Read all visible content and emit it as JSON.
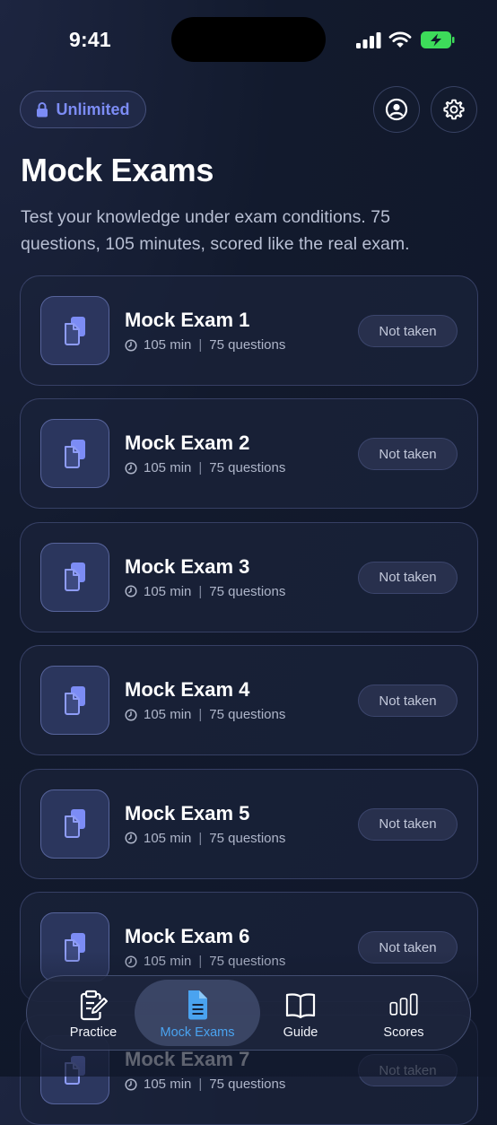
{
  "status_bar": {
    "time": "9:41"
  },
  "header": {
    "plan_label": "Unlimited",
    "title": "Mock Exams",
    "subtitle": "Test your knowledge under exam conditions. 75 questions, 105 minutes, scored like the real exam."
  },
  "exams": [
    {
      "title": "Mock Exam 1",
      "duration": "105 min",
      "questions": "75 questions",
      "status": "Not taken"
    },
    {
      "title": "Mock Exam 2",
      "duration": "105 min",
      "questions": "75 questions",
      "status": "Not taken"
    },
    {
      "title": "Mock Exam 3",
      "duration": "105 min",
      "questions": "75 questions",
      "status": "Not taken"
    },
    {
      "title": "Mock Exam 4",
      "duration": "105 min",
      "questions": "75 questions",
      "status": "Not taken"
    },
    {
      "title": "Mock Exam 5",
      "duration": "105 min",
      "questions": "75 questions",
      "status": "Not taken"
    },
    {
      "title": "Mock Exam 6",
      "duration": "105 min",
      "questions": "75 questions",
      "status": "Not taken"
    },
    {
      "title": "Mock Exam 7",
      "duration": "105 min",
      "questions": "75 questions",
      "status": "Not taken"
    }
  ],
  "tabs": [
    {
      "label": "Practice",
      "icon": "clipboard-edit-icon"
    },
    {
      "label": "Mock Exams",
      "icon": "document-icon",
      "active": true
    },
    {
      "label": "Guide",
      "icon": "book-icon"
    },
    {
      "label": "Scores",
      "icon": "bar-chart-icon"
    }
  ],
  "colors": {
    "accent": "#7c8cf5",
    "active_tab": "#4aa3f0",
    "battery": "#3ddc5a"
  }
}
